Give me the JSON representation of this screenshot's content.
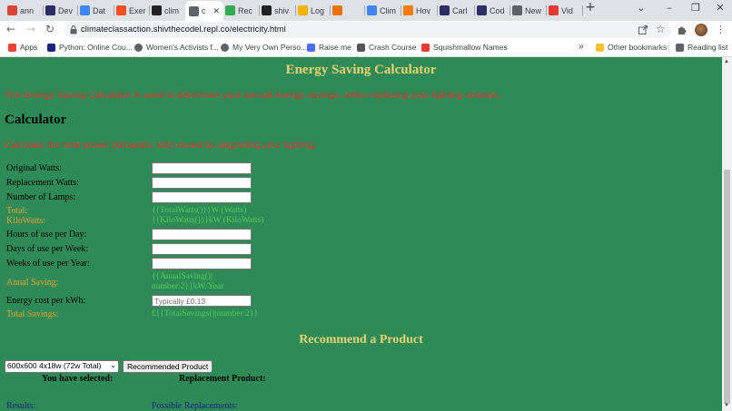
{
  "browser": {
    "tabs": [
      {
        "label": "ann",
        "icon": "google-circle-icon",
        "color": "#db4437"
      },
      {
        "label": "Dev",
        "icon": "dev-d-icon",
        "color": "#2d2d66"
      },
      {
        "label": "Dat",
        "icon": "doc-icon",
        "color": "#4285f4"
      },
      {
        "label": "Exer",
        "icon": "windows-grid-icon",
        "color": "#f25022"
      },
      {
        "label": "clim",
        "icon": "box-icon",
        "color": "#222222"
      },
      {
        "label": "c",
        "icon": "globe-icon",
        "color": "#5f6368",
        "active": true
      },
      {
        "label": "Rec",
        "icon": "drive-icon",
        "color": "#34a853"
      },
      {
        "label": "shiv",
        "icon": "github-icon",
        "color": "#222222"
      },
      {
        "label": "Log",
        "icon": "flag-icon",
        "color": "#f4b400"
      },
      {
        "label": "",
        "icon": "shield-icon",
        "color": "#e8710a"
      },
      {
        "label": "Clim",
        "icon": "doc-icon",
        "color": "#4285f4"
      },
      {
        "label": "Hov",
        "icon": "hover-icon",
        "color": "#f57c00"
      },
      {
        "label": "Carl",
        "icon": "dev-d-icon",
        "color": "#2d2d66"
      },
      {
        "label": "Cod",
        "icon": "dev-d-icon",
        "color": "#2d2d66"
      },
      {
        "label": "New",
        "icon": "globe-icon",
        "color": "#5f6368"
      },
      {
        "label": "Vid",
        "icon": "video-icon",
        "color": "#e53935"
      }
    ],
    "close_glyph": "✕",
    "new_tab_glyph": "+",
    "url": "climateclassaction.shivthecodel.repl.co/electricity.html",
    "bookmarks": [
      {
        "label": "Apps",
        "icon": "apps-grid-icon",
        "color": "#ea4335"
      },
      {
        "label": "Python: Online Cou...",
        "icon": "python-icon",
        "color": "#1a237e"
      },
      {
        "label": "Women's Activists f...",
        "icon": "globe-icon",
        "color": "#5f6368"
      },
      {
        "label": "My Very Own Perso...",
        "icon": "globe-icon",
        "color": "#5f6368"
      },
      {
        "label": "Raise me",
        "icon": "raise-icon",
        "color": "#4a6cf7"
      },
      {
        "label": "Crash Course",
        "icon": "crashcourse-icon",
        "color": "#555555"
      },
      {
        "label": "Squishmallow Names",
        "icon": "fire-icon",
        "color": "#e53935"
      }
    ],
    "overflow_glyph": "»",
    "other_bookmarks": "Other bookmarks",
    "reading_list": "Reading list"
  },
  "page": {
    "heading": "Energy Saving Calculator",
    "intro": "The Energy Saving Calculator is used to determine your annual energy savings, when replacing your lighting solution.",
    "calc_heading": "Calculator",
    "calc_intro": "Calculate the total power (kilowatts, kW) saved by upgrading your lighting.",
    "fields": {
      "original_watts": "Original Watts:",
      "replacement_watts": "Replacement Watts:",
      "number_of_lamps": "Number of Lamps:",
      "total_label": "Total:",
      "total_value": "{{TotalWatts()}}W (Watts)",
      "kilowatts_label": "KiloWatts:",
      "kilowatts_value": "{{KiloWatts()}}kW (KiloWatts)",
      "hours_per_day": "Hours of use per Day:",
      "days_per_week": "Days of use per Week:",
      "weeks_per_year": "Weeks of use per Year:",
      "annual_saving_label": "Anual Saving:",
      "annual_saving_value_1": "{{AnualSaving()|",
      "annual_saving_value_2": "number:2}}kW/Year",
      "energy_cost": "Energy cost per kWh:",
      "energy_cost_placeholder": "Typically £0.13",
      "total_savings_label": "Total Savings:",
      "total_savings_value": "£{{TotalSavings()|number:2}}"
    },
    "recommend_heading": "Recommend a Product",
    "product_select": "600x600 4x18w (72w Total)",
    "recommend_button": "Recommended Product",
    "you_selected": "You have selected:",
    "replacement_product": "Replacement Product:",
    "results": "Results:",
    "possible_replacements": "Possible Replacements:"
  }
}
